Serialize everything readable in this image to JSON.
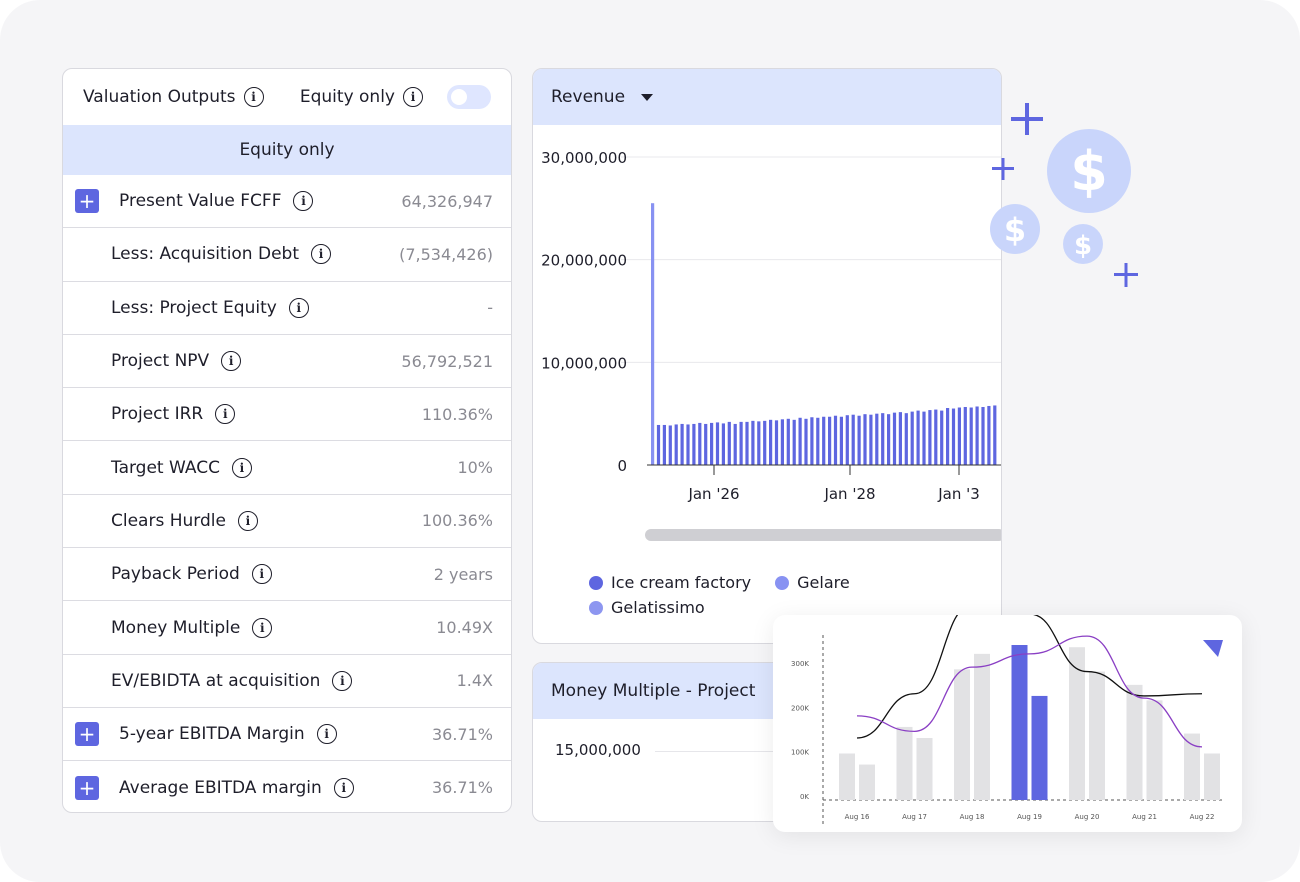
{
  "valuation": {
    "title": "Valuation Outputs",
    "equity_toggle_label": "Equity only",
    "section_label": "Equity only",
    "rows": [
      {
        "label": "Present Value FCFF",
        "value": "64,326,947",
        "expandable": true
      },
      {
        "label": "Less: Acquisition Debt",
        "value": "(7,534,426)",
        "expandable": false
      },
      {
        "label": "Less: Project Equity",
        "value": "-",
        "expandable": false
      },
      {
        "label": "Project NPV",
        "value": "56,792,521",
        "expandable": false
      },
      {
        "label": "Project IRR",
        "value": "110.36%",
        "expandable": false
      },
      {
        "label": "Target WACC",
        "value": "10%",
        "expandable": false
      },
      {
        "label": "Clears Hurdle",
        "value": "100.36%",
        "expandable": false
      },
      {
        "label": "Payback Period",
        "value": "2 years",
        "expandable": false
      },
      {
        "label": "Money Multiple",
        "value": "10.49X",
        "expandable": false
      },
      {
        "label": "EV/EBIDTA at acquisition",
        "value": "1.4X",
        "expandable": false
      },
      {
        "label": "5-year EBITDA Margin",
        "value": "36.71%",
        "expandable": true
      },
      {
        "label": "Average EBITDA margin",
        "value": "36.71%",
        "expandable": true
      }
    ]
  },
  "revenue_panel": {
    "dropdown_label": "Revenue",
    "legend": [
      {
        "name": "Ice cream factory",
        "color": "#5e66e0"
      },
      {
        "name": "Gelare",
        "color": "#8892f2"
      },
      {
        "name": "Gelatissimo",
        "color": "#8d96f0"
      }
    ]
  },
  "money_multiple_panel": {
    "title": "Money Multiple - Project",
    "tick": "15,000,000"
  },
  "chart_data": [
    {
      "type": "bar",
      "title": "",
      "xlabel": "",
      "ylabel": "",
      "ylim": [
        0,
        30000000
      ],
      "yticks": [
        "30,000,000",
        "20,000,000",
        "10,000,000",
        "0"
      ],
      "xticks": [
        "Jan '26",
        "Jan '28",
        "Jan '3"
      ],
      "series_color": "#5e66e0",
      "values": [
        25500000,
        3900000,
        3900000,
        3850000,
        3950000,
        4000000,
        3950000,
        4000000,
        4100000,
        4000000,
        4100000,
        4150000,
        4050000,
        4200000,
        4000000,
        4200000,
        4200000,
        4300000,
        4250000,
        4300000,
        4400000,
        4350000,
        4450000,
        4500000,
        4400000,
        4600000,
        4500000,
        4650000,
        4600000,
        4700000,
        4700000,
        4800000,
        4700000,
        4850000,
        4900000,
        4800000,
        4950000,
        4900000,
        5000000,
        5050000,
        4950000,
        5100000,
        5150000,
        5050000,
        5200000,
        5300000,
        5200000,
        5350000,
        5400000,
        5300000,
        5550000,
        5500000,
        5600000,
        5650000,
        5600000,
        5700000,
        5650000,
        5750000,
        5800000
      ],
      "grid": true
    },
    {
      "type": "bar",
      "title": "",
      "yticks": [
        "300K",
        "200K",
        "100K",
        "0K"
      ],
      "ylim": [
        0,
        350000
      ],
      "categories": [
        "Aug 16",
        "Aug 17",
        "Aug 18",
        "Aug 19",
        "Aug 20",
        "Aug 21",
        "Aug 22"
      ],
      "series": [
        {
          "values": [
            105000,
            165000,
            295000,
            350000,
            345000,
            260000,
            150000
          ]
        },
        {
          "values": [
            80000,
            140000,
            330000,
            235000,
            290000,
            225000,
            105000
          ]
        }
      ],
      "highlight_category": "Aug 19",
      "highlight_color": "#5e66e0",
      "base_color": "#e2e2e4",
      "lines": [
        {
          "color": "#111111",
          "values": [
            140000,
            240000,
            440000,
            420000,
            290000,
            235000,
            240000
          ]
        },
        {
          "color": "#8a3fc4",
          "values": [
            190000,
            155000,
            300000,
            330000,
            370000,
            230000,
            120000
          ]
        }
      ]
    }
  ],
  "colors": {
    "accent": "#5e66e0",
    "light_blue": "#dce5fd",
    "coin": "#c9d5fb"
  },
  "icons": [
    "info-icon",
    "plus-icon",
    "dollar-coin-icon",
    "caret-down-icon",
    "triangle-marker-icon"
  ]
}
